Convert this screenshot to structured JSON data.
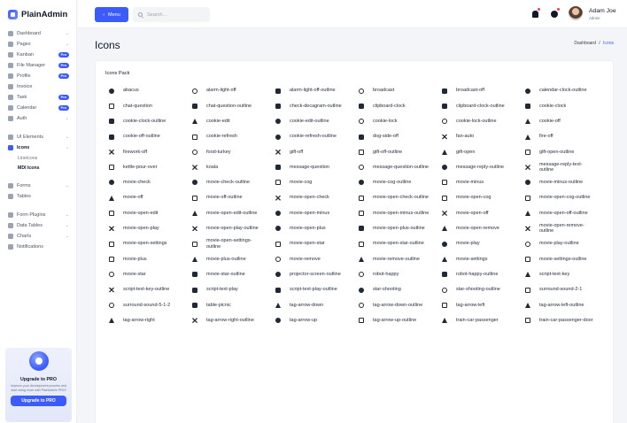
{
  "app": {
    "name": "PlainAdmin"
  },
  "sidebar": {
    "groups": [
      [
        {
          "label": "Dashboard",
          "chev": true,
          "icon": "dashboard-icon"
        },
        {
          "label": "Pages",
          "chev": true,
          "icon": "pages-icon"
        },
        {
          "label": "Kanban",
          "badge": "Pro",
          "icon": "kanban-icon"
        },
        {
          "label": "File Manager",
          "badge": "Pro",
          "icon": "file-manager-icon"
        },
        {
          "label": "Profile",
          "badge": "Pro",
          "icon": "profile-icon"
        },
        {
          "label": "Invoice",
          "icon": "invoice-icon"
        },
        {
          "label": "Task",
          "badge": "Pro",
          "icon": "task-icon"
        },
        {
          "label": "Calendar",
          "badge": "Pro",
          "icon": "calendar-icon"
        },
        {
          "label": "Auth",
          "chev": true,
          "icon": "auth-icon"
        }
      ],
      [
        {
          "label": "UI Elements",
          "chev": true,
          "icon": "ui-elements-icon"
        },
        {
          "label": "Icons",
          "chev": true,
          "active": true,
          "icon": "icons-icon",
          "sub": [
            {
              "label": "LineIcons"
            },
            {
              "label": "MDI Icons",
              "active": true
            }
          ]
        }
      ],
      [
        {
          "label": "Forms",
          "chev": true,
          "icon": "forms-icon"
        },
        {
          "label": "Tables",
          "icon": "tables-icon"
        }
      ],
      [
        {
          "label": "Form Plugins",
          "chev": true,
          "icon": "form-plugins-icon"
        },
        {
          "label": "Data Tables",
          "chev": true,
          "icon": "data-tables-icon"
        },
        {
          "label": "Charts",
          "chev": true,
          "icon": "charts-icon"
        },
        {
          "label": "Notifications",
          "icon": "notifications-icon"
        }
      ]
    ],
    "promo": {
      "title": "Upgrade to PRO",
      "text": "Improve your development process and start doing more with PlainAdmin PRO!",
      "button": "Upgrade to PRO"
    }
  },
  "header": {
    "menu_label": "Menu",
    "search_placeholder": "Search...",
    "user": {
      "name": "Adam Joe",
      "role": "Admin"
    }
  },
  "page": {
    "title": "Icons",
    "breadcrumb": {
      "home": "Dashboard",
      "separator": "/",
      "current": "Icons"
    }
  },
  "card": {
    "title": "Icons Pack",
    "icons": [
      "abacus",
      "alarm-light-off",
      "alarm-light-off-outline",
      "broadcast",
      "broadcast-off",
      "calendar-clock-outline",
      "chat-question",
      "chat-question-outline",
      "check-decagram-outline",
      "clipboard-clock",
      "clipboard-clock-outline",
      "cookie-clock",
      "cookie-clock-outline",
      "cookie-edit",
      "cookie-edit-outline",
      "cookie-lock",
      "cookie-lock-outline",
      "cookie-off",
      "cookie-off-outline",
      "cookie-refresh",
      "cookie-refresh-outline",
      "dog-side-off",
      "fan-auto",
      "fire-off",
      "firework-off",
      "food-turkey",
      "gift-off",
      "gift-off-outline",
      "gift-open",
      "gift-open-outline",
      "kettle-pour-over",
      "koala",
      "message-question",
      "message-question-outline",
      "message-reply-outline",
      "message-reply-text-outline",
      "movie-check",
      "movie-check-outline",
      "movie-cog",
      "movie-cog-outline",
      "movie-minus",
      "movie-minus-outline",
      "movie-off",
      "movie-off-outline",
      "movie-open-check",
      "movie-open-check-outline",
      "movie-open-cog",
      "movie-open-cog-outline",
      "movie-open-edit",
      "movie-open-edit-outline",
      "movie-open-minus",
      "movie-open-minus-outline",
      "movie-open-off",
      "movie-open-off-outline",
      "movie-open-play",
      "movie-open-play-outline",
      "movie-open-plus",
      "movie-open-plus-outline",
      "movie-open-remove",
      "movie-open-remove-outline",
      "movie-open-settings",
      "movie-open-settings-outline",
      "movie-open-star",
      "movie-open-star-outline",
      "movie-play",
      "movie-play-outline",
      "movie-plus",
      "movie-plus-outline",
      "movie-remove",
      "movie-remove-outline",
      "movie-settings",
      "movie-settings-outline",
      "movie-star",
      "movie-star-outline",
      "projector-screen-outline",
      "robot-happy",
      "robot-happy-outline",
      "script-text-key",
      "script-text-key-outline",
      "script-text-play",
      "script-text-play-outline",
      "star-shooting",
      "star-shooting-outline",
      "surround-sound-2-1",
      "surround-sound-5-1-2",
      "table-picnic",
      "tag-arrow-down",
      "tag-arrow-down-outline",
      "tag-arrow-left",
      "tag-arrow-left-outline",
      "tag-arrow-right",
      "tag-arrow-right-outline",
      "tag-arrow-up",
      "tag-arrow-up-outline",
      "train-car-passenger",
      "train-car-passenger-door"
    ]
  }
}
